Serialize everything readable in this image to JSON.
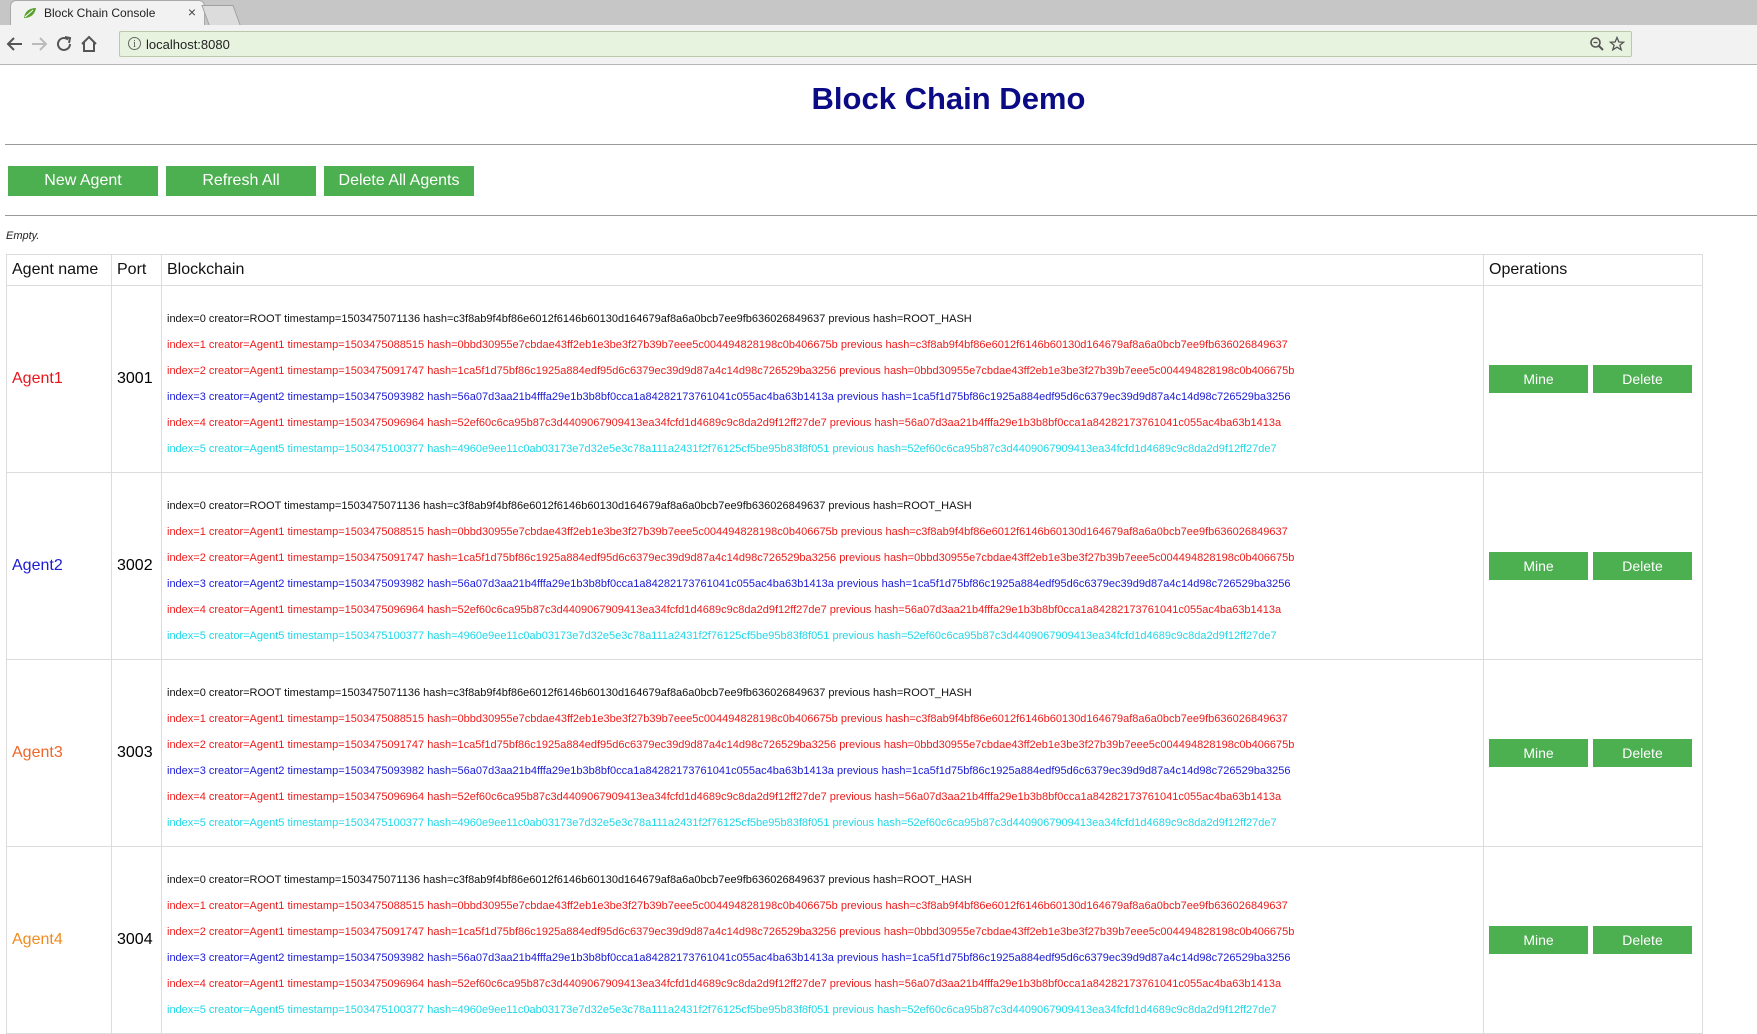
{
  "browser": {
    "tab_title": "Block Chain Console",
    "tab_close": "×",
    "url": "localhost:8080"
  },
  "page": {
    "title": "Block Chain Demo",
    "buttons": {
      "new_agent": "New Agent",
      "refresh_all": "Refresh All",
      "delete_all": "Delete All Agents"
    },
    "status": "Empty.",
    "table": {
      "headers": {
        "agent_name": "Agent name",
        "port": "Port",
        "blockchain": "Blockchain",
        "operations": "Operations"
      },
      "rows": [
        {
          "name": "Agent1",
          "name_color": "#e8161b",
          "port": "3001"
        },
        {
          "name": "Agent2",
          "name_color": "#1b1bd6",
          "port": "3002"
        },
        {
          "name": "Agent3",
          "name_color": "#f0662a",
          "port": "3003"
        },
        {
          "name": "Agent4",
          "name_color": "#ef8b1e",
          "port": "3004"
        }
      ],
      "blocks": [
        {
          "text": "index=0 creator=ROOT timestamp=1503475071136 hash=c3f8ab9f4bf86e6012f6146b60130d164679af8a6a0bcb7ee9fb636026849637 previous hash=ROOT_HASH",
          "color": "#111111"
        },
        {
          "text": "index=1 creator=Agent1 timestamp=1503475088515 hash=0bbd30955e7cbdae43ff2eb1e3be3f27b39b7eee5c004494828198c0b406675b previous hash=c3f8ab9f4bf86e6012f6146b60130d164679af8a6a0bcb7ee9fb636026849637",
          "color": "#ee1b1b"
        },
        {
          "text": "index=2 creator=Agent1 timestamp=1503475091747 hash=1ca5f1d75bf86c1925a884edf95d6c6379ec39d9d87a4c14d98c726529ba3256 previous hash=0bbd30955e7cbdae43ff2eb1e3be3f27b39b7eee5c004494828198c0b406675b",
          "color": "#ee1b1b"
        },
        {
          "text": "index=3 creator=Agent2 timestamp=1503475093982 hash=56a07d3aa21b4fffa29e1b3b8bf0cca1a84282173761041c055ac4ba63b1413a previous hash=1ca5f1d75bf86c1925a884edf95d6c6379ec39d9d87a4c14d98c726529ba3256",
          "color": "#1b1bd6"
        },
        {
          "text": "index=4 creator=Agent1 timestamp=1503475096964 hash=52ef60c6ca95b87c3d4409067909413ea34fcfd1d4689c9c8da2d9f12ff27de7 previous hash=56a07d3aa21b4fffa29e1b3b8bf0cca1a84282173761041c055ac4ba63b1413a",
          "color": "#ee1b1b"
        },
        {
          "text": "index=5 creator=Agent5 timestamp=1503475100377 hash=4960e9ee11c0ab03173e7d32e5e3c78a111a2431f2f76125cf5be95b83f8f051 previous hash=52ef60c6ca95b87c3d4409067909413ea34fcfd1d4689c9c8da2d9f12ff27de7",
          "color": "#1ed8e8"
        }
      ],
      "ops": {
        "mine": "Mine",
        "delete": "Delete"
      }
    }
  },
  "colors": {
    "accent_green": "#4caf50",
    "title_navy": "#0b0b86"
  },
  "icons": [
    "leaf-favicon-icon",
    "back-arrow-icon",
    "forward-arrow-icon",
    "reload-icon",
    "home-icon",
    "info-icon",
    "zoom-icon",
    "star-icon"
  ]
}
